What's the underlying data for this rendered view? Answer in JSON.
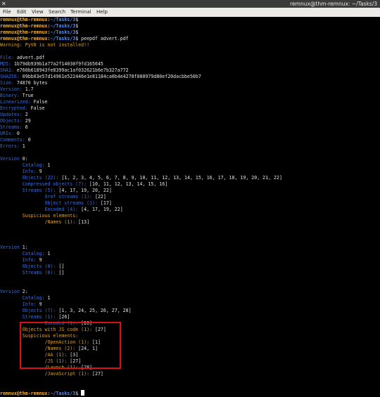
{
  "window": {
    "title": "remnux@thm-remnux: ~/Tasks/3",
    "close_glyph": "✕"
  },
  "menu": [
    "File",
    "Edit",
    "View",
    "Search",
    "Terminal",
    "Help"
  ],
  "prompt": {
    "user": "remnux@thm-remnux:",
    "path": "~/Tasks/3",
    "sym": "$"
  },
  "lines": [
    {
      "p": true,
      "cmd": ""
    },
    {
      "p": true,
      "cmd": ""
    },
    {
      "p": true,
      "cmd": ""
    },
    {
      "p": true,
      "cmd": "peepdf advert.pdf"
    },
    {
      "s": [
        {
          "t": "Warning: PyV8 is not installed!!",
          "c": "o"
        }
      ]
    },
    {
      "s": []
    },
    {
      "s": [
        {
          "t": "File: ",
          "c": "k"
        },
        {
          "t": "advert.pdf",
          "c": "w"
        }
      ]
    },
    {
      "s": [
        {
          "t": "MD5: ",
          "c": "k"
        },
        {
          "t": "1b79db939b1a77a2f14030f9fd165645",
          "c": "w"
        }
      ]
    },
    {
      "s": [
        {
          "t": "SHA1: ",
          "c": "k"
        },
        {
          "t": "e760b618943fe8399ac1af032621b6e7b327a772",
          "c": "w"
        }
      ]
    },
    {
      "s": [
        {
          "t": "SHA256: ",
          "c": "k"
        },
        {
          "t": "09bb03e57d14961e522446e1e81184ca0b4e4278f080979d80ef20dacbbe50b7",
          "c": "w"
        }
      ]
    },
    {
      "s": [
        {
          "t": "Size: ",
          "c": "k"
        },
        {
          "t": "74870 bytes",
          "c": "w"
        }
      ]
    },
    {
      "s": [
        {
          "t": "Version: ",
          "c": "k"
        },
        {
          "t": "1.7",
          "c": "w"
        }
      ]
    },
    {
      "s": [
        {
          "t": "Binary: ",
          "c": "k"
        },
        {
          "t": "True",
          "c": "w"
        }
      ]
    },
    {
      "s": [
        {
          "t": "Linearized: ",
          "c": "k"
        },
        {
          "t": "False",
          "c": "w"
        }
      ]
    },
    {
      "s": [
        {
          "t": "Encrypted: ",
          "c": "k"
        },
        {
          "t": "False",
          "c": "w"
        }
      ]
    },
    {
      "s": [
        {
          "t": "Updates: ",
          "c": "k"
        },
        {
          "t": "2",
          "c": "w"
        }
      ]
    },
    {
      "s": [
        {
          "t": "Objects: ",
          "c": "k"
        },
        {
          "t": "29",
          "c": "w"
        }
      ]
    },
    {
      "s": [
        {
          "t": "Streams: ",
          "c": "k"
        },
        {
          "t": "6",
          "c": "w"
        }
      ]
    },
    {
      "s": [
        {
          "t": "URIs: ",
          "c": "k"
        },
        {
          "t": "0",
          "c": "w"
        }
      ]
    },
    {
      "s": [
        {
          "t": "Comments: ",
          "c": "k"
        },
        {
          "t": "0",
          "c": "w"
        }
      ]
    },
    {
      "s": [
        {
          "t": "Errors: ",
          "c": "k"
        },
        {
          "t": "1",
          "c": "w"
        }
      ]
    },
    {
      "s": []
    },
    {
      "s": [
        {
          "t": "Version ",
          "c": "k"
        },
        {
          "t": "0:",
          "c": "w"
        }
      ]
    },
    {
      "s": [
        {
          "t": "\tCatalog: ",
          "c": "k"
        },
        {
          "t": "1",
          "c": "w"
        }
      ]
    },
    {
      "s": [
        {
          "t": "\tInfo: ",
          "c": "k"
        },
        {
          "t": "9",
          "c": "w"
        }
      ]
    },
    {
      "s": [
        {
          "t": "\tObjects (22): ",
          "c": "k"
        },
        {
          "t": "[1, 2, 3, 4, 5, 6, 7, 8, 9, 10, 11, 12, 13, 14, 15, 16, 17, 18, 19, 20, 21, 22]",
          "c": "w"
        }
      ]
    },
    {
      "s": [
        {
          "t": "\tCompressed objects (7): ",
          "c": "k"
        },
        {
          "t": "[10, 11, 12, 13, 14, 15, 16]",
          "c": "w"
        }
      ]
    },
    {
      "s": [
        {
          "t": "\tStreams (5): ",
          "c": "k"
        },
        {
          "t": "[4, 17, 19, 20, 22]",
          "c": "w"
        }
      ]
    },
    {
      "s": [
        {
          "t": "\t\tXref streams (1): ",
          "c": "k"
        },
        {
          "t": "[22]",
          "c": "w"
        }
      ]
    },
    {
      "s": [
        {
          "t": "\t\tObject streams (1): ",
          "c": "k"
        },
        {
          "t": "[17]",
          "c": "w"
        }
      ]
    },
    {
      "s": [
        {
          "t": "\t\tEncoded (4): ",
          "c": "k"
        },
        {
          "t": "[4, 17, 19, 22]",
          "c": "w"
        }
      ]
    },
    {
      "s": [
        {
          "t": "\tSuspicious elements:",
          "c": "o"
        }
      ]
    },
    {
      "s": [
        {
          "t": "\t\t/Names (1): ",
          "c": "o"
        },
        {
          "t": "[13]",
          "c": "w"
        }
      ]
    },
    {
      "s": []
    },
    {
      "s": []
    },
    {
      "s": []
    },
    {
      "s": [
        {
          "t": "Version ",
          "c": "k"
        },
        {
          "t": "1:",
          "c": "w"
        }
      ]
    },
    {
      "s": [
        {
          "t": "\tCatalog: ",
          "c": "k"
        },
        {
          "t": "1",
          "c": "w"
        }
      ]
    },
    {
      "s": [
        {
          "t": "\tInfo: ",
          "c": "k"
        },
        {
          "t": "9",
          "c": "w"
        }
      ]
    },
    {
      "s": [
        {
          "t": "\tObjects (0): ",
          "c": "k"
        },
        {
          "t": "[]",
          "c": "w"
        }
      ]
    },
    {
      "s": [
        {
          "t": "\tStreams (0): ",
          "c": "k"
        },
        {
          "t": "[]",
          "c": "w"
        }
      ]
    },
    {
      "s": []
    },
    {
      "s": []
    },
    {
      "s": [
        {
          "t": "Version ",
          "c": "k"
        },
        {
          "t": "2:",
          "c": "w"
        }
      ]
    },
    {
      "s": [
        {
          "t": "\tCatalog: ",
          "c": "k"
        },
        {
          "t": "1",
          "c": "w"
        }
      ]
    },
    {
      "s": [
        {
          "t": "\tInfo: ",
          "c": "k"
        },
        {
          "t": "9",
          "c": "w"
        }
      ]
    },
    {
      "s": [
        {
          "t": "\tObjects (7): ",
          "c": "k"
        },
        {
          "t": "[1, 3, 24, 25, 26, 27, 28]",
          "c": "w"
        }
      ]
    },
    {
      "s": [
        {
          "t": "\tStreams (1): ",
          "c": "k"
        },
        {
          "t": "[26]",
          "c": "w"
        }
      ]
    },
    {
      "s": [
        {
          "t": "\t\tEncoded (1): ",
          "c": "k"
        },
        {
          "t": "[26]",
          "c": "w"
        }
      ]
    },
    {
      "s": [
        {
          "t": "\tObjects with JS code (1): ",
          "c": "o"
        },
        {
          "t": "[27]",
          "c": "w"
        }
      ]
    },
    {
      "s": [
        {
          "t": "\tSuspicious elements:",
          "c": "o"
        }
      ]
    },
    {
      "s": [
        {
          "t": "\t\t/OpenAction (1): ",
          "c": "o"
        },
        {
          "t": "[1]",
          "c": "w"
        }
      ]
    },
    {
      "s": [
        {
          "t": "\t\t/Names (2): ",
          "c": "o"
        },
        {
          "t": "[24, 1]",
          "c": "w"
        }
      ]
    },
    {
      "s": [
        {
          "t": "\t\t/AA (1): ",
          "c": "o"
        },
        {
          "t": "[3]",
          "c": "w"
        }
      ]
    },
    {
      "s": [
        {
          "t": "\t\t/JS (1): ",
          "c": "o"
        },
        {
          "t": "[27]",
          "c": "w"
        }
      ]
    },
    {
      "s": [
        {
          "t": "\t\t/Launch (1): ",
          "c": "o"
        },
        {
          "t": "[28]",
          "c": "w"
        }
      ]
    },
    {
      "s": [
        {
          "t": "\t\t/JavaScript (1): ",
          "c": "o"
        },
        {
          "t": "[27]",
          "c": "w"
        }
      ]
    },
    {
      "s": []
    },
    {
      "s": []
    },
    {
      "p": true,
      "cmd": "",
      "cursor": true
    }
  ]
}
